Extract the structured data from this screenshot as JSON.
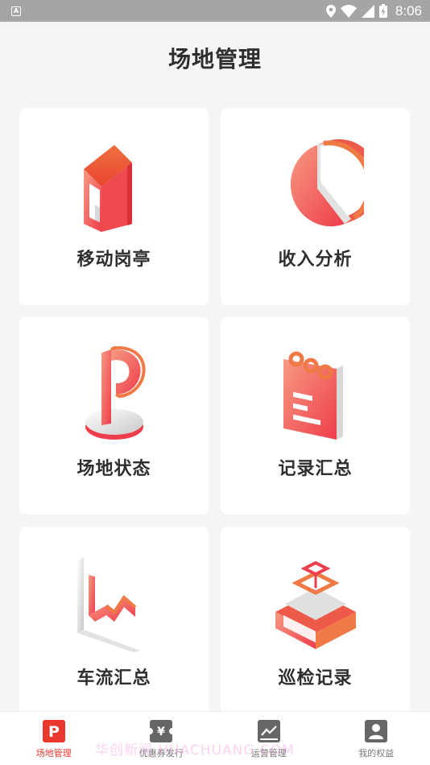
{
  "status_bar": {
    "notification_badge": "A",
    "time": "8:06"
  },
  "page": {
    "title": "场地管理"
  },
  "cards": [
    {
      "label": "移动岗亭",
      "icon": "booth-house-icon"
    },
    {
      "label": "收入分析",
      "icon": "pie-chart-icon"
    },
    {
      "label": "场地状态",
      "icon": "parking-sign-icon"
    },
    {
      "label": "记录汇总",
      "icon": "notepad-icon"
    },
    {
      "label": "车流汇总",
      "icon": "trend-chart-icon"
    },
    {
      "label": "巡检记录",
      "icon": "inspection-device-icon"
    }
  ],
  "bottom_nav": {
    "items": [
      {
        "label": "场地管理",
        "icon": "parking-p-icon",
        "active": true
      },
      {
        "label": "优惠券发行",
        "icon": "ticket-yuan-icon",
        "active": false
      },
      {
        "label": "运营管理",
        "icon": "line-chart-icon",
        "active": false
      },
      {
        "label": "我的权益",
        "icon": "user-icon",
        "active": false
      }
    ]
  },
  "watermark": "华创新闻 HUACHUANG.COM",
  "colors": {
    "accent": "#e8382f",
    "icon_gradient_start": "#f57e60",
    "icon_gradient_end": "#ee3d4b",
    "status_bar": "#a5a5a5"
  }
}
